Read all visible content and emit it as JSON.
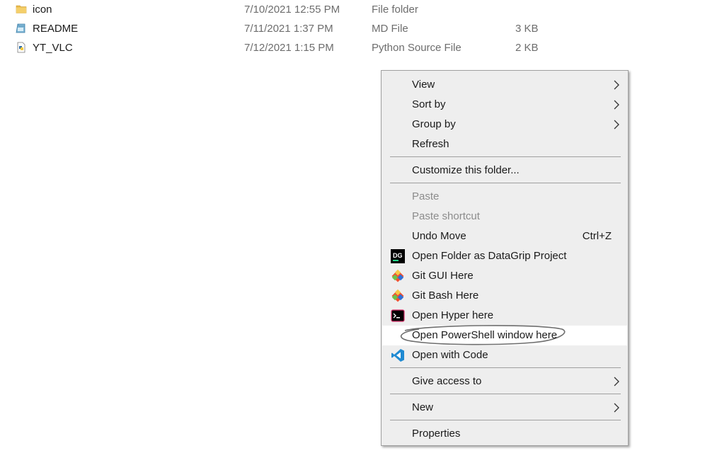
{
  "files": [
    {
      "name": "icon",
      "date": "7/10/2021 12:55 PM",
      "type": "File folder",
      "size": "",
      "icon": "folder-icon"
    },
    {
      "name": "README",
      "date": "7/11/2021 1:37 PM",
      "type": "MD File",
      "size": "3 KB",
      "icon": "md-file-icon"
    },
    {
      "name": "YT_VLC",
      "date": "7/12/2021 1:15 PM",
      "type": "Python Source File",
      "size": "2 KB",
      "icon": "python-file-icon"
    }
  ],
  "menu": {
    "view": "View",
    "sort_by": "Sort by",
    "group_by": "Group by",
    "refresh": "Refresh",
    "customize": "Customize this folder...",
    "paste": "Paste",
    "paste_shortcut": "Paste shortcut",
    "undo_move": "Undo Move",
    "undo_shortcut": "Ctrl+Z",
    "datagrip": "Open Folder as DataGrip Project",
    "datagrip_icon_text": "DG",
    "git_gui": "Git GUI Here",
    "git_bash": "Git Bash Here",
    "hyper": "Open Hyper here",
    "powershell": "Open PowerShell window here",
    "vscode": "Open with Code",
    "give_access": "Give access to",
    "new": "New",
    "properties": "Properties"
  },
  "colors": {
    "menu_bg": "#eeeeee",
    "highlight_bg": "#ffffff",
    "disabled_text": "#8c8c8c",
    "folder": "#e8b84a",
    "git": "#f05133",
    "vscode": "#1f8ad2",
    "datagrip_bg": "#000000",
    "datagrip_accent": "#21d789"
  }
}
